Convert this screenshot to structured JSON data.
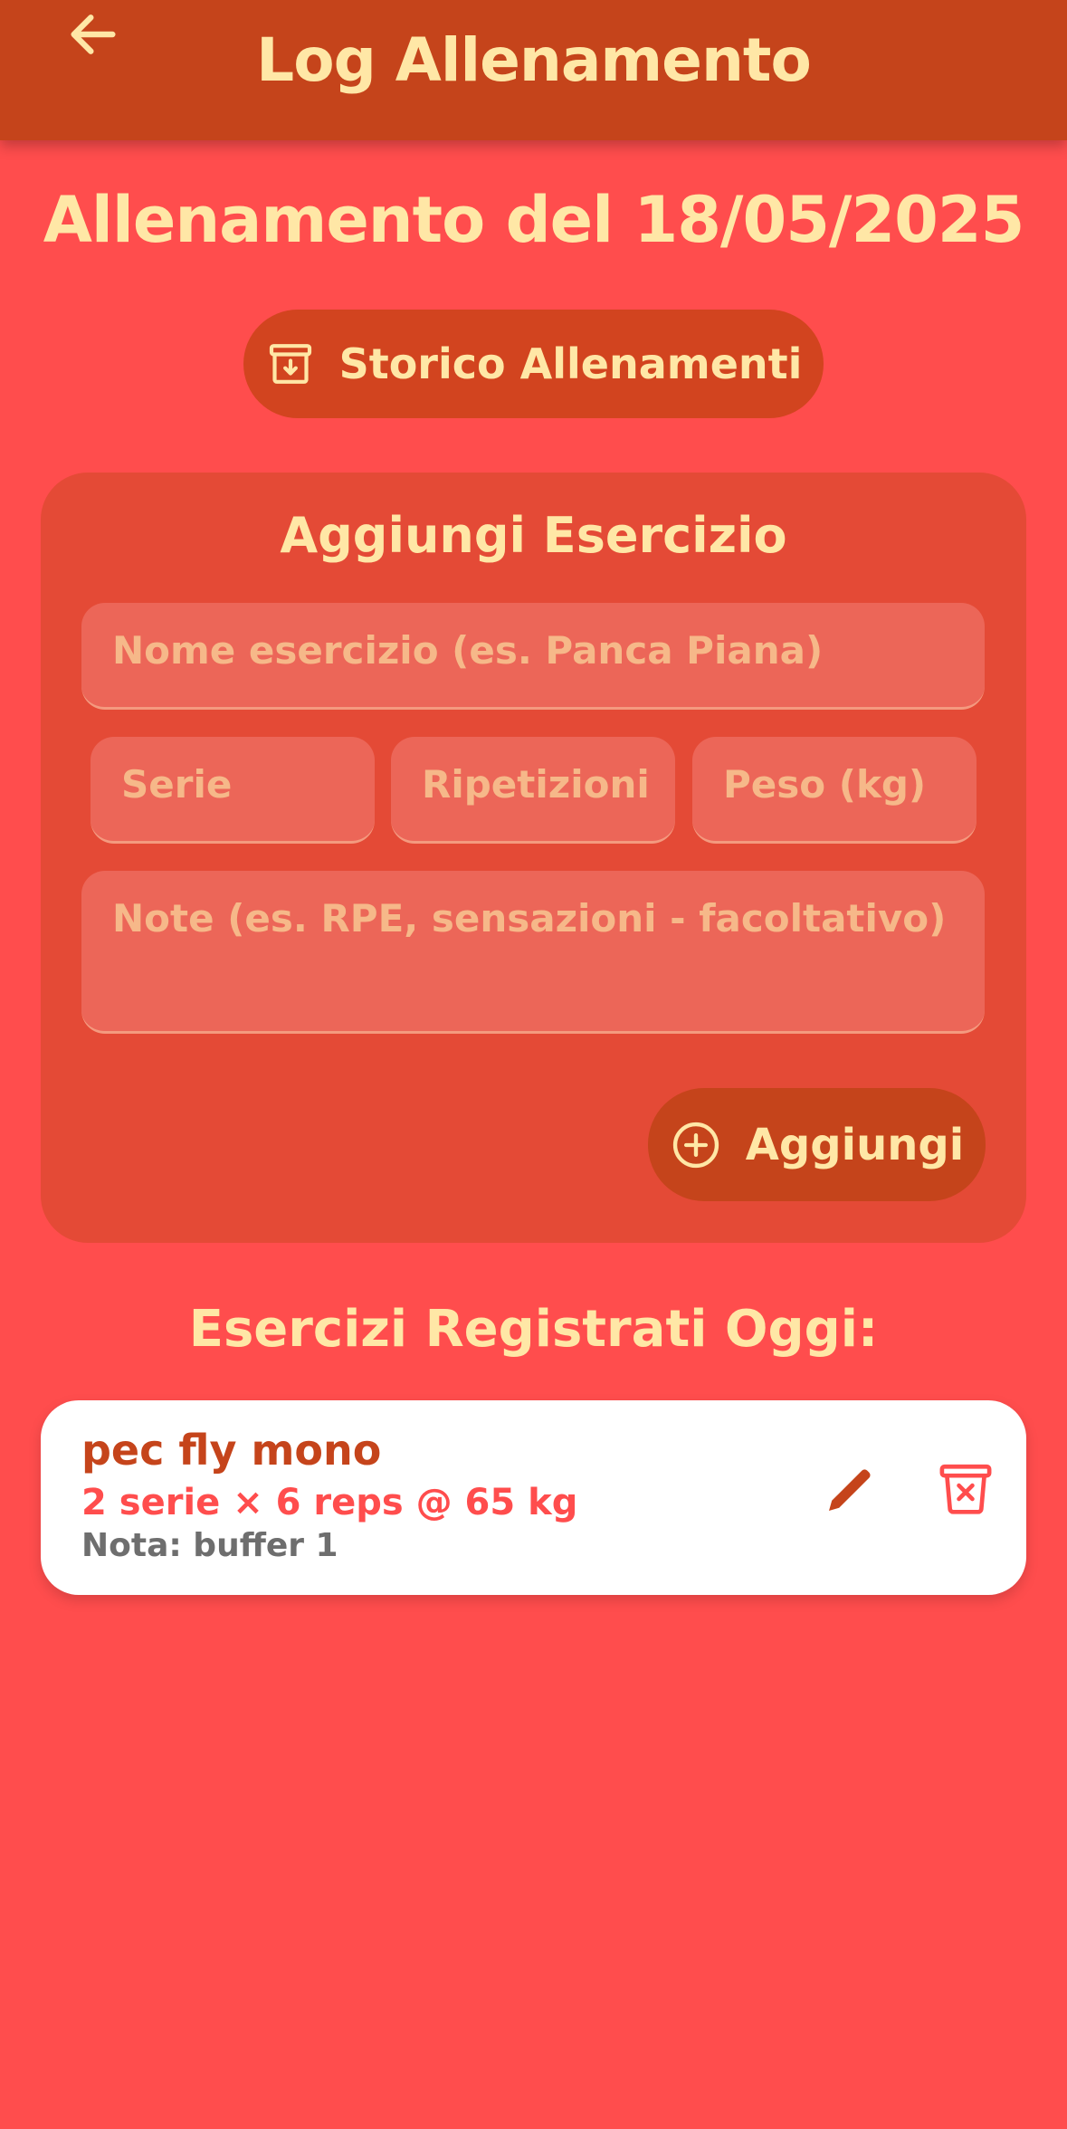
{
  "header": {
    "title": "Log Allenamento",
    "back_icon": "arrow-left-icon"
  },
  "main": {
    "date_title": "Allenamento del 18/05/2025",
    "history_button": {
      "label": "Storico Allenamenti",
      "icon": "archive-icon"
    }
  },
  "add_form": {
    "title": "Aggiungi Esercizio",
    "name_placeholder": "Nome esercizio (es. Panca Piana)",
    "sets_placeholder": "Serie",
    "reps_placeholder": "Ripetizioni",
    "weight_placeholder": "Peso (kg)",
    "notes_placeholder": "Note (es. RPE, sensazioni - facoltativo)",
    "add_button": {
      "label": "Aggiungi",
      "icon": "plus-circle-icon"
    }
  },
  "logged": {
    "title": "Esercizi Registrati Oggi:",
    "entries": [
      {
        "name": "pec fly mono",
        "detail": "2 serie × 6 reps @ 65 kg",
        "note": "Nota: buffer 1",
        "edit_icon": "pencil-icon",
        "delete_icon": "trash-icon"
      }
    ]
  },
  "colors": {
    "background": "#ff4d4d",
    "header": "#c5441b",
    "card": "#e44a36",
    "accent_text": "#ffe7a6"
  }
}
